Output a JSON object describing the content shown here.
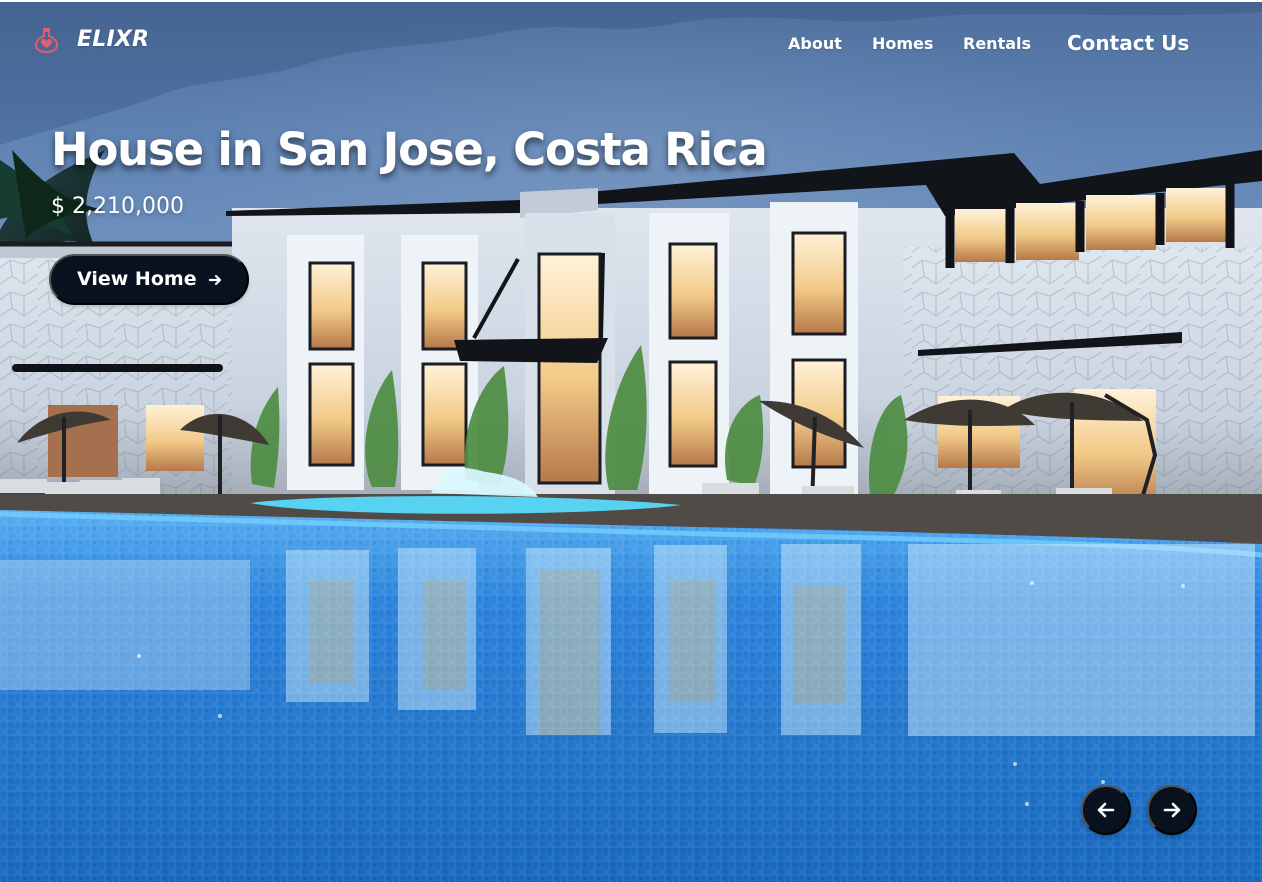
{
  "brand": {
    "name": "ELIXR",
    "icon": "potion-heart-icon"
  },
  "nav": {
    "items": [
      {
        "label": "About"
      },
      {
        "label": "Homes"
      },
      {
        "label": "Rentals"
      }
    ],
    "contact": "Contact Us"
  },
  "hero": {
    "title": "House in San Jose, Costa Rica",
    "price": "$ 2,210,000",
    "cta": {
      "label": "View Home",
      "icon": "arrow-right-icon"
    },
    "image": {
      "subject": "illuminated white villa with pool at dusk"
    }
  },
  "carousel": {
    "previous_icon": "arrow-left-icon",
    "next_icon": "arrow-right-icon"
  },
  "colors": {
    "button_background": "#08111d",
    "text": "#ffffff",
    "brand_icon": "#e85b6d",
    "pool": "#1d72cc",
    "sky": "#5f83b4"
  }
}
